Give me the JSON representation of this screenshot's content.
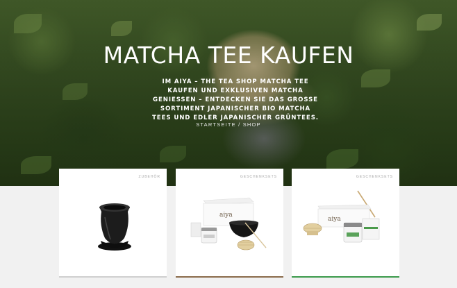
{
  "hero": {
    "title": "MATCHA TEE KAUFEN",
    "description": "IM AIYA – THE TEA SHOP MATCHA TEE KAUFEN UND EXKLUSIVEN MATCHA GENIESSEN – ENTDECKEN SIE DAS GROSSE SORTIMENT JAPANISCHER BIO MATCHA TEES UND EDLER JAPANISCHER GRÜNTEES.",
    "breadcrumb": {
      "home": "STARTSEITE",
      "separator": "/",
      "current": "SHOP"
    }
  },
  "products": [
    {
      "category": "ZUBEHÖR",
      "image": "matcha-whisk-holder",
      "accent": "#cfcfcf"
    },
    {
      "category": "GESCHENKSETS",
      "image": "gift-set-bowl-whisk",
      "brand": "aiya",
      "accent": "#8a6a4a"
    },
    {
      "category": "GESCHENKSETS",
      "image": "gift-set-whisk-tins",
      "brand": "aiya",
      "accent": "#3a9a4a"
    }
  ],
  "colors": {
    "page_bg": "#f1f1f1",
    "card_bg": "#ffffff"
  }
}
